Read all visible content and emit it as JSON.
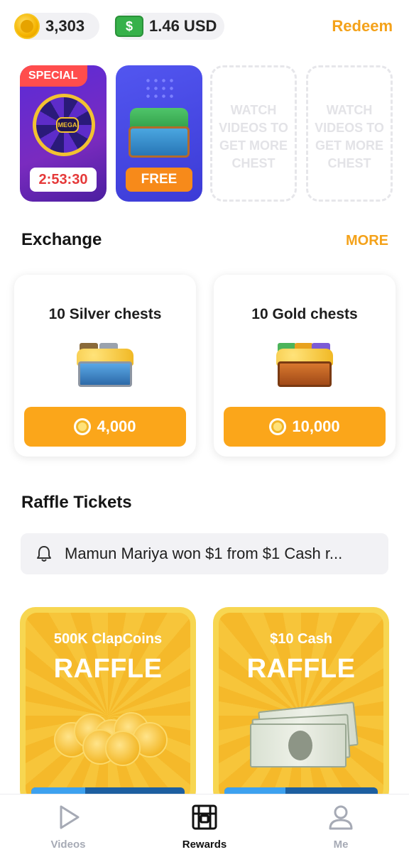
{
  "header": {
    "coins": "3,303",
    "cash": "1.46 USD",
    "cash_icon_glyph": "$",
    "redeem_label": "Redeem"
  },
  "chests": {
    "special": {
      "tag": "SPECIAL",
      "wheel_center": "MEGA",
      "timer": "2:53:30"
    },
    "free": {
      "label": "FREE"
    },
    "empty_slots": [
      {
        "text": "WATCH VIDEOS TO GET MORE CHEST"
      },
      {
        "text": "WATCH VIDEOS TO GET MORE CHEST"
      }
    ]
  },
  "exchange": {
    "heading": "Exchange",
    "more_label": "MORE",
    "items": [
      {
        "title": "10 Silver chests",
        "price": "4,000"
      },
      {
        "title": "10 Gold chests",
        "price": "10,000"
      }
    ]
  },
  "raffle": {
    "heading": "Raffle Tickets",
    "ticker": "Mamun Mariya won $1 from $1 Cash r...",
    "cards": [
      {
        "title": "500K ClapCoins",
        "big": "RAFFLE",
        "progress": 0.35
      },
      {
        "title": "$10 Cash",
        "big": "RAFFLE",
        "progress": 0.4
      }
    ]
  },
  "nav": {
    "items": [
      {
        "label": "Videos",
        "icon": "play-icon",
        "active": false
      },
      {
        "label": "Rewards",
        "icon": "treasure-chest-icon",
        "active": true
      },
      {
        "label": "Me",
        "icon": "user-icon",
        "active": false
      }
    ]
  },
  "colors": {
    "accent": "#f4a21a",
    "button": "#fba61a",
    "special_tag": "#ff4d4d",
    "timer_text": "#e53939"
  }
}
